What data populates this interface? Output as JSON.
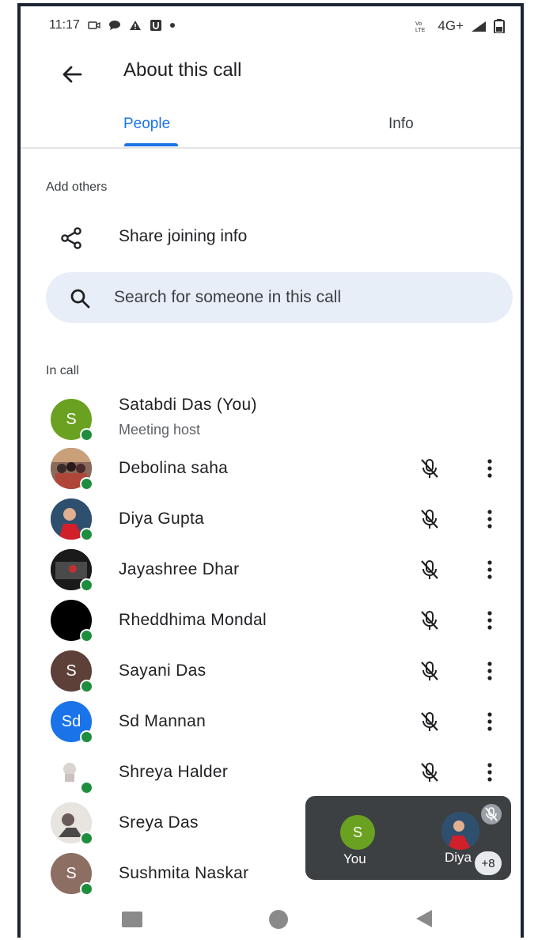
{
  "status_bar": {
    "time": "11:17",
    "network": "4G+"
  },
  "app_bar": {
    "title": "About this call"
  },
  "tabs": [
    {
      "label": "People",
      "active": true
    },
    {
      "label": "Info",
      "active": false
    }
  ],
  "add_others": {
    "section_label": "Add others",
    "share_label": "Share joining info",
    "search_placeholder": "Search for someone in this call"
  },
  "in_call": {
    "section_label": "In call",
    "participants": [
      {
        "name": "Satabdi Das (You)",
        "subtitle": "Meeting host",
        "initials": "S",
        "avatar_color": "#6aa121"
      },
      {
        "name": "Debolina saha",
        "initials": "",
        "avatar_color": "#7a5a4a"
      },
      {
        "name": "Diya Gupta",
        "initials": "",
        "avatar_color": "#3f6a8a"
      },
      {
        "name": "Jayashree Dhar",
        "initials": "",
        "avatar_color": "#2a2a2a"
      },
      {
        "name": "Rheddhima Mondal",
        "initials": "",
        "avatar_color": "#000000"
      },
      {
        "name": "Sayani Das",
        "initials": "S",
        "avatar_color": "#5d4037"
      },
      {
        "name": "Sd Mannan",
        "initials": "Sd",
        "avatar_color": "#1a73e8"
      },
      {
        "name": "Shreya Halder",
        "initials": "",
        "avatar_color": "#d9d4cf"
      },
      {
        "name": "Sreya Das",
        "initials": "",
        "avatar_color": "#c9c2bd"
      },
      {
        "name": "Sushmita Naskar",
        "initials": "S",
        "avatar_color": "#8d6e63"
      }
    ]
  },
  "mini_call": {
    "you_initial": "S",
    "you_label": "You",
    "other_label": "Diya",
    "more_count": "+8"
  }
}
